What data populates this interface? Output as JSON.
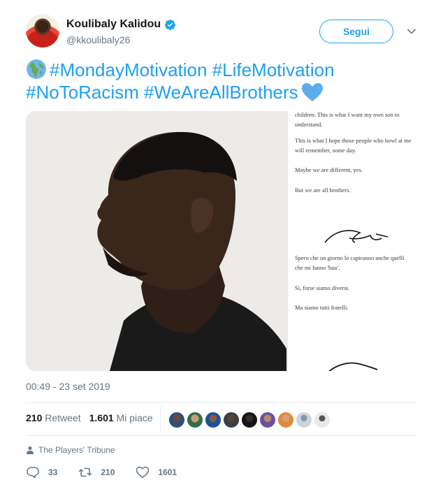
{
  "user": {
    "name": "Koulibaly Kalidou",
    "handle": "@kkoulibaly26",
    "follow_label": "Segui"
  },
  "tweet": {
    "line1": "#MondayMotivation #LifeMotivation",
    "line2": "#NoToRacism #WeAreAllBrothers",
    "timestamp": "00:49 - 23 set 2019"
  },
  "letter": {
    "p1": "children. This is what I want my own son to understand.",
    "p2": "This is what I hope those people who howl at me will remember, some day.",
    "p3": "Maybe we are different, yes.",
    "p4": "But we are all brothers.",
    "p5": "Spero che un giorno lo capiranno anche quelli che mi fanno 'buu'.",
    "p6": "Sì, forse siamo diversi.",
    "p7": "Ma siamo tutti fratelli."
  },
  "stats": {
    "retweet_count": "210",
    "retweet_label": "Retweet",
    "like_count": "1.601",
    "like_label": "Mi piace"
  },
  "source": "The Players' Tribune",
  "actions": {
    "reply": "33",
    "retweet": "210",
    "like": "1601"
  },
  "colors": {
    "accent": "#1da1f2",
    "text": "#14171a",
    "muted": "#657786",
    "divider": "#e6ecf0"
  },
  "icons": [
    "verified-badge-icon",
    "chevron-down-icon",
    "globe-emoji-icon",
    "blue-heart-emoji-icon",
    "person-icon",
    "reply-icon",
    "retweet-icon",
    "like-icon"
  ]
}
